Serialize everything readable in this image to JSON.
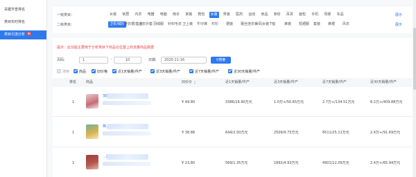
{
  "sidebar": {
    "items": [
      {
        "label": "关键字查排名",
        "active": false
      },
      {
        "label": "类目实时排名",
        "active": false
      },
      {
        "label": "类目引流分析",
        "active": true,
        "badge": "新"
      }
    ]
  },
  "filters": {
    "primary": {
      "label": "一级类目：",
      "items": [
        "女装",
        "家居",
        "内衣",
        "电器",
        "电脑",
        "雨伞",
        "家装",
        "鞋包",
        "女装",
        "男装",
        "医药",
        "运动",
        "食品",
        "家纺",
        "百货",
        "面包",
        "手机",
        "母婴",
        "车品"
      ],
      "selected_index": 8,
      "expand_label": "展示"
    },
    "secondary": {
      "label": "二级类目：",
      "items": [
        "卫衣/绒衫",
        "连衣裙/套装",
        "上衣外套",
        "羽绒服",
        "针织毛衣",
        "卫上装",
        "牛仔裤",
        "衬衫",
        "裙装",
        "蕾丝连衣衫",
        "大码女装",
        "T恤",
        "裤装",
        "短裙服",
        "套装",
        "裤裙",
        "风衣"
      ],
      "selected_index": 0,
      "expand_label": "展示"
    }
  },
  "tip": "提示：此功能主要用于分析类目下商品在位置上的流量商品数据",
  "controls": {
    "page_label": "页码:",
    "page_from": "1",
    "page_to": "10",
    "date_label": "日期:",
    "date_value": "2020-11-16",
    "search_label": "搜索"
  },
  "metrics": [
    {
      "label": "搜索",
      "checked": false,
      "disabled": true
    },
    {
      "label": "商品",
      "checked": true
    },
    {
      "label": "旧价格",
      "checked": true
    },
    {
      "label": "近1天销量/件产",
      "checked": true
    },
    {
      "label": "近3天销量/件产",
      "checked": true
    },
    {
      "label": "近7天销量/件产",
      "checked": true
    },
    {
      "label": "近30天销量/件产",
      "checked": true
    }
  ],
  "table": {
    "headers": [
      "排名",
      "商品",
      "旧价价",
      "近1天销量/件产",
      "近3天销量/件产",
      "近7天销量/件产",
      "近30天销量/件产"
    ],
    "rows": [
      {
        "rank": "1",
        "title_visible": "加厚...款潮流显瘦...",
        "price": "¥ 49.80",
        "d1": "3386/16.90万元",
        "d3": "1.0万+/50.65万元",
        "d7": "2.7万+/134.51万元",
        "d30": "8.2万+/409.88万元",
        "thumb_color": "#c76b78"
      },
      {
        "rank": "1",
        "title_visible": "棉...10款韩版女生...",
        "price": "¥ 38.88",
        "d1": "644/2.50万元",
        "d3": "2509/9.75万元",
        "d7": "6511/25.11万元",
        "d30": "2.4万+/91.69万元",
        "thumb_color": "#d9b24f"
      },
      {
        "rank": "1",
        "title_visible": "...套[29.8元]...",
        "price": "¥ 23.80",
        "d1": "569/1.35万元",
        "d3": "1892/4.93万元",
        "d7": "4901/12.09万元",
        "d30": "2.4万+/65.94万元",
        "thumb_color": "#b5554a"
      }
    ]
  }
}
